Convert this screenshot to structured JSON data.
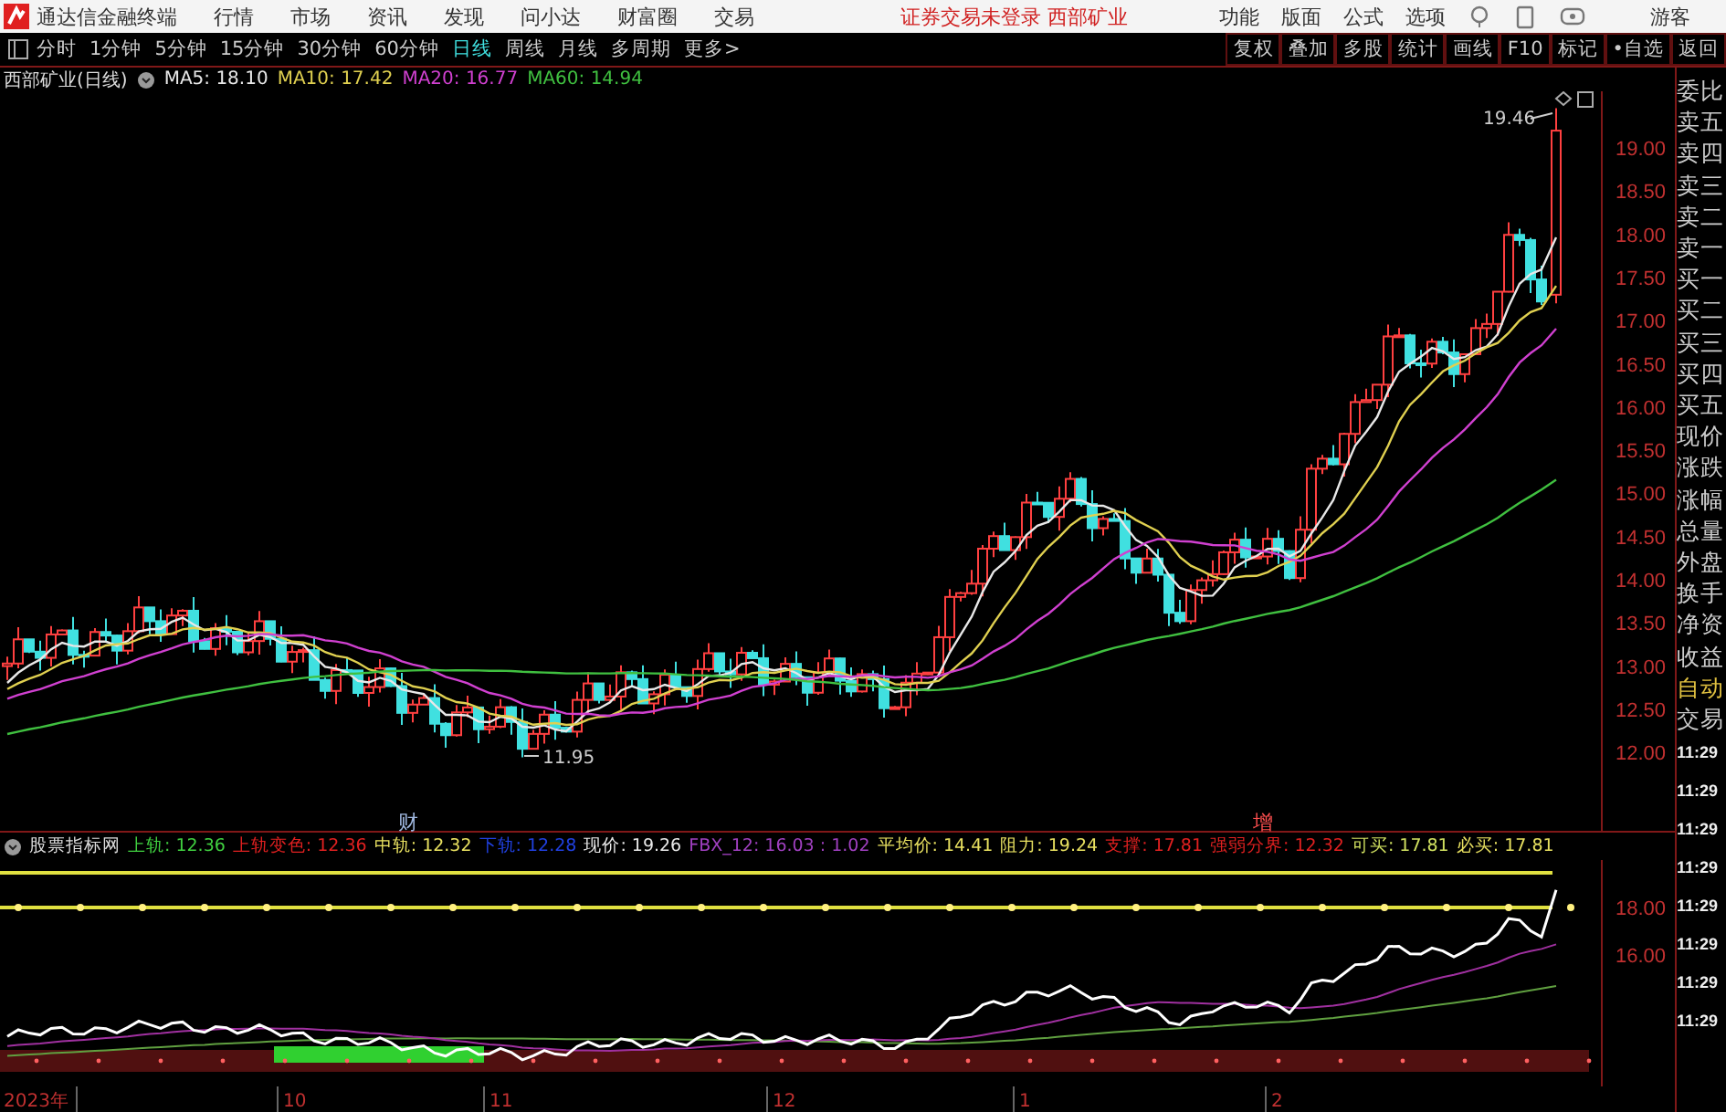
{
  "menu_bar": {
    "app_name": "通达信金融终端",
    "items": [
      "行情",
      "市场",
      "资讯",
      "发现",
      "问小达",
      "财富圈",
      "交易"
    ],
    "status": "证券交易未登录 西部矿业",
    "right_items": [
      "功能",
      "版面",
      "公式",
      "选项"
    ],
    "user": "游客"
  },
  "toolbar": {
    "periods": [
      {
        "label": "分时",
        "selected": false
      },
      {
        "label": "1分钟",
        "selected": false
      },
      {
        "label": "5分钟",
        "selected": false
      },
      {
        "label": "15分钟",
        "selected": false
      },
      {
        "label": "30分钟",
        "selected": false
      },
      {
        "label": "60分钟",
        "selected": false
      },
      {
        "label": "日线",
        "selected": true
      },
      {
        "label": "周线",
        "selected": false
      },
      {
        "label": "月线",
        "selected": false
      },
      {
        "label": "多周期",
        "selected": false
      },
      {
        "label": "更多>",
        "selected": false
      }
    ],
    "buttons": [
      "复权",
      "叠加",
      "多股",
      "统计",
      "画线",
      "F10",
      "标记",
      "•自选",
      "返回"
    ]
  },
  "price_chart": {
    "title": "西部矿业(日线)",
    "ma_legend": [
      {
        "text": "MA5: 18.10",
        "color": "#e8e8e8"
      },
      {
        "text": "MA10: 17.42",
        "color": "#e0d050"
      },
      {
        "text": "MA20: 16.77",
        "color": "#d040d0"
      },
      {
        "text": "MA60: 14.94",
        "color": "#40c040"
      }
    ],
    "axis_labels": [
      "19.00",
      "18.50",
      "18.00",
      "17.50",
      "17.00",
      "16.50",
      "16.00",
      "15.50",
      "15.00",
      "14.50",
      "14.00",
      "13.50",
      "13.00",
      "12.50",
      "12.00"
    ],
    "high_label": "19.46",
    "low_label": "11.95",
    "markers": [
      {
        "text": "财",
        "color": "#a0b8e0"
      },
      {
        "text": "增",
        "color": "#ff5050"
      }
    ]
  },
  "indicator": {
    "title": "股票指标网",
    "legend": [
      {
        "text": "上轨: 12.36",
        "color": "#40d040"
      },
      {
        "text": "上轨变色: 12.36",
        "color": "#e02020"
      },
      {
        "text": "中轨: 12.32",
        "color": "#e8e060"
      },
      {
        "text": "下轨: 12.28",
        "color": "#2040e0"
      },
      {
        "text": "现价: 19.26",
        "color": "#e8e8e8"
      },
      {
        "text": "FBX_12: 16.03 : 1.02",
        "color": "#a040c0"
      },
      {
        "text": "平均价: 14.41",
        "color": "#e8e060"
      },
      {
        "text": "阻力: 19.24",
        "color": "#e8e060"
      },
      {
        "text": "支撑: 17.81",
        "color": "#e02020"
      },
      {
        "text": "强弱分界: 12.32",
        "color": "#e02020"
      },
      {
        "text": "可买: 17.81",
        "color": "#d0e060"
      },
      {
        "text": "必买: 17.81",
        "color": "#e8e060"
      }
    ],
    "axis_labels": [
      "18.00",
      "16.00"
    ]
  },
  "time_axis": [
    "2023年",
    "10",
    "11",
    "12",
    "1",
    "2"
  ],
  "quote_panel": {
    "labels": [
      "委比",
      "卖五",
      "卖四",
      "卖三",
      "卖二",
      "卖一",
      "买一",
      "买二",
      "买三",
      "买四",
      "买五",
      "现价",
      "涨跌",
      "涨幅",
      "总量",
      "外盘",
      "换手",
      "净资",
      "收益",
      "自动",
      "交易"
    ],
    "times": [
      "11:29",
      "11:29",
      "11:29",
      "11:29",
      "11:29",
      "11:29",
      "11:29",
      "11:29"
    ]
  }
}
